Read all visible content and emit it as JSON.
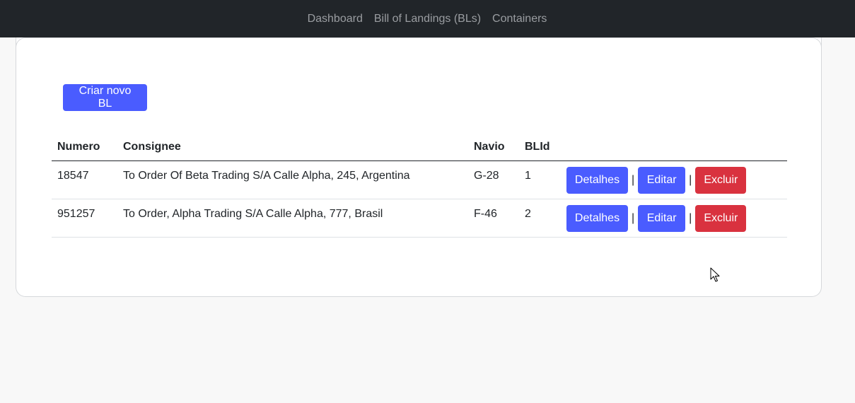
{
  "navbar": {
    "links": [
      {
        "label": "Dashboard"
      },
      {
        "label": "Bill of Landings (BLs)"
      },
      {
        "label": "Containers"
      }
    ]
  },
  "main": {
    "create_button_label": "Criar novo BL",
    "table": {
      "headers": [
        "Numero",
        "Consignee",
        "Navio",
        "BLId",
        ""
      ],
      "rows": [
        {
          "numero": "18547",
          "consignee": "To Order Of Beta Trading S/A Calle Alpha, 245, Argentina",
          "navio": "G-28",
          "blid": "1"
        },
        {
          "numero": "951257",
          "consignee": "To Order, Alpha Trading S/A Calle Alpha, 777, Brasil",
          "navio": "F-46",
          "blid": "2"
        }
      ],
      "actions": {
        "details_label": "Detalhes",
        "edit_label": "Editar",
        "delete_label": "Excluir",
        "separator": "|"
      }
    }
  },
  "colors": {
    "navbar_bg": "#212529",
    "primary": "#4a5cff",
    "danger": "#d9323f",
    "page_bg": "#f8f8f8"
  },
  "icons": {
    "cursor": "mouse-pointer-icon"
  }
}
